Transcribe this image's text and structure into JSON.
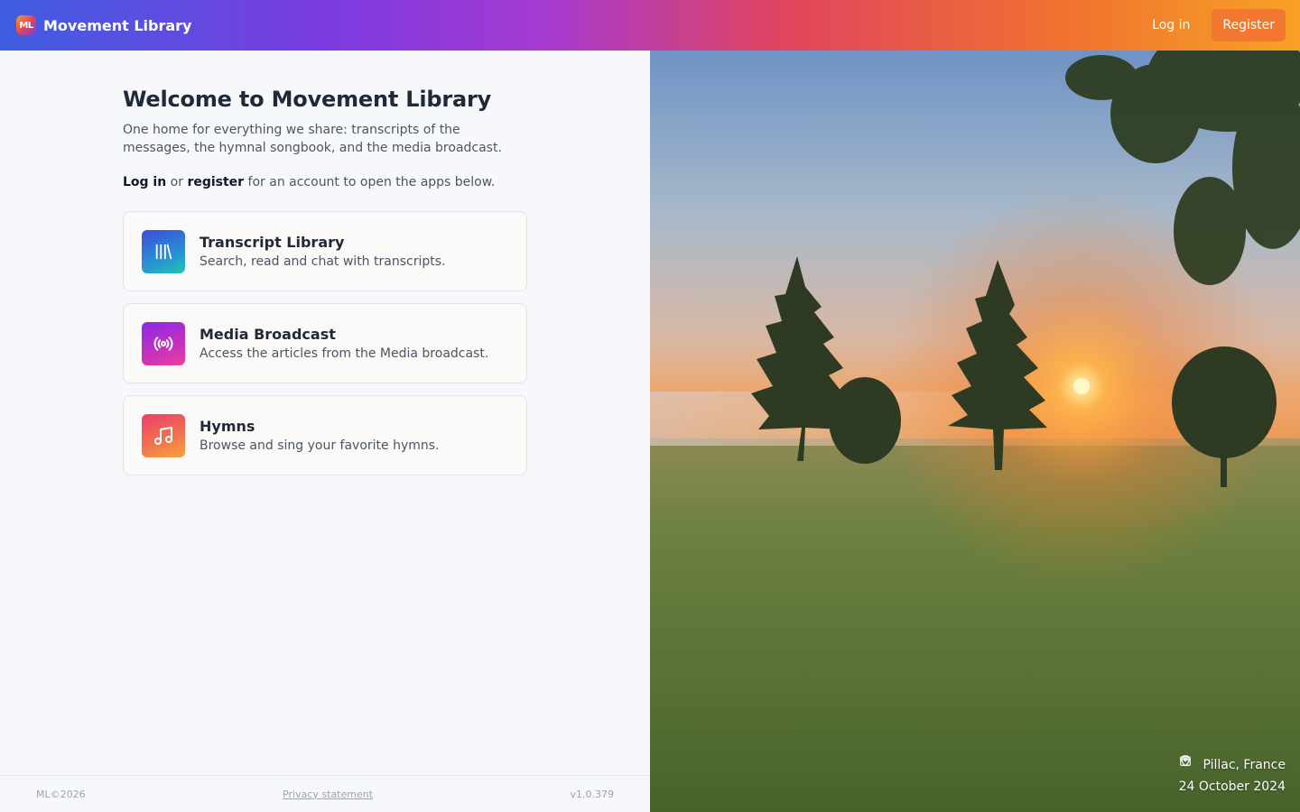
{
  "header": {
    "logo_text": "ML",
    "app_name": "Movement Library",
    "login_label": "Log in",
    "register_label": "Register"
  },
  "main": {
    "title": "Welcome to Movement Library",
    "intro": "One home for everything we share: transcripts of the messages, the hymnal songbook, and the media broadcast.",
    "auth_login": "Log in",
    "auth_or": "or",
    "auth_register": "register",
    "auth_suffix": "for an account to open the apps below.",
    "apps": [
      {
        "title": "Transcript Library",
        "description": "Search, read and chat with transcripts.",
        "icon": "library-icon"
      },
      {
        "title": "Media Broadcast",
        "description": "Access the articles from the Media broadcast.",
        "icon": "broadcast-icon"
      },
      {
        "title": "Hymns",
        "description": "Browse and sing your favorite hymns.",
        "icon": "music-note-icon"
      }
    ]
  },
  "footer": {
    "copyright": "ML©2026",
    "privacy_label": "Privacy statement",
    "version": "v1.0.379"
  },
  "photo": {
    "location": "Pillac, France",
    "date": "24 October 2024"
  },
  "colors": {
    "register_button": "#f2782f",
    "page_background": "#f7f8fc"
  }
}
